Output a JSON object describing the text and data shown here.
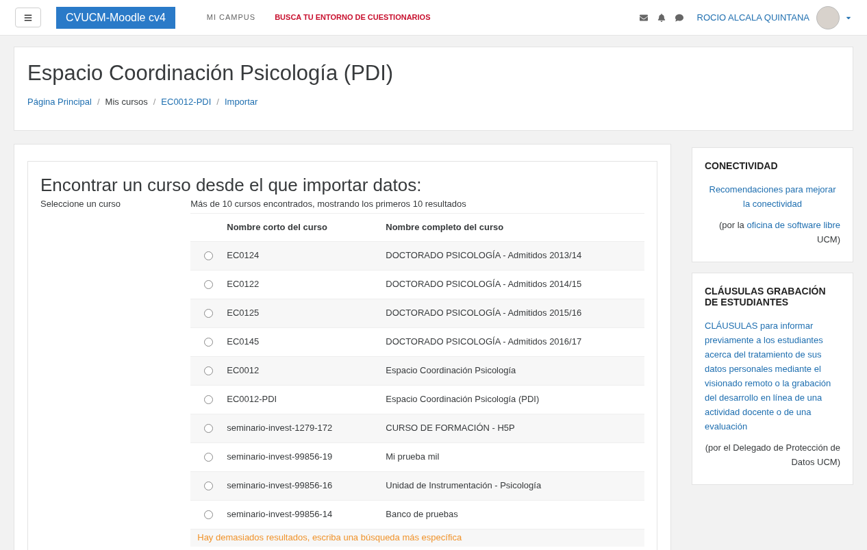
{
  "navbar": {
    "brand": "CVUCM-Moodle cv4",
    "links": [
      {
        "label": "MI CAMPUS",
        "kind": "plain"
      },
      {
        "label": "BUSCA TU ENTORNO DE CUESTIONARIOS",
        "kind": "highlight"
      }
    ],
    "user": "ROCIO ALCALA QUINTANA"
  },
  "header": {
    "title": "Espacio Coordinación Psicología (PDI)",
    "separator": "/",
    "breadcrumb": [
      {
        "label": "Página Principal",
        "link": true
      },
      {
        "label": "Mis cursos",
        "link": false
      },
      {
        "label": "EC0012-PDI",
        "link": true
      },
      {
        "label": "Importar",
        "link": true
      }
    ]
  },
  "main": {
    "title": "Encontrar un curso desde el que importar datos:",
    "label": "Seleccione un curso",
    "summary": "Más de 10 cursos encontrados, mostrando los primeros 10 resultados",
    "columns": [
      "Nombre corto del curso",
      "Nombre completo del curso"
    ],
    "rows": [
      {
        "short": "EC0124",
        "full": "DOCTORADO PSICOLOGÍA - Admitidos 2013/14",
        "selected": false
      },
      {
        "short": "EC0122",
        "full": "DOCTORADO PSICOLOGÍA - Admitidos 2014/15",
        "selected": false
      },
      {
        "short": "EC0125",
        "full": "DOCTORADO PSICOLOGÍA - Admitidos 2015/16",
        "selected": false
      },
      {
        "short": "EC0145",
        "full": "DOCTORADO PSICOLOGÍA - Admitidos 2016/17",
        "selected": false
      },
      {
        "short": "EC0012",
        "full": "Espacio Coordinación Psicología",
        "selected": false
      },
      {
        "short": "EC0012-PDI",
        "full": "Espacio Coordinación Psicología (PDI)",
        "selected": false
      },
      {
        "short": "seminario-invest-1279-172",
        "full": "CURSO DE FORMACIÓN - H5P",
        "selected": false
      },
      {
        "short": "seminario-invest-99856-19",
        "full": "Mi prueba mil",
        "selected": false
      },
      {
        "short": "seminario-invest-99856-16",
        "full": "Unidad de Instrumentación - Psicología",
        "selected": false
      },
      {
        "short": "seminario-invest-99856-14",
        "full": "Banco de pruebas",
        "selected": false
      }
    ],
    "warning": "Hay demasiados resultados, escriba una búsqueda más específica"
  },
  "blocks": [
    {
      "title": "CONECTIVIDAD",
      "link": "Recomendaciones para mejorar la conectividad",
      "kind": "centered",
      "note_prefix": "(por la ",
      "note_link": "oficina de software libre",
      "note_suffix": " UCM)"
    },
    {
      "title": "CLÁUSULAS GRABACIÓN DE ESTUDIANTES",
      "link": "CLÁUSULAS para informar previamente a los estudiantes acerca del tratamiento de sus datos personales mediante el visionado remoto o la grabación del desarrollo en línea de una actividad docente o de una evaluación",
      "kind": "paragraph",
      "note_prefix": "(por el Delegado de Protección de Datos UCM)"
    }
  ]
}
